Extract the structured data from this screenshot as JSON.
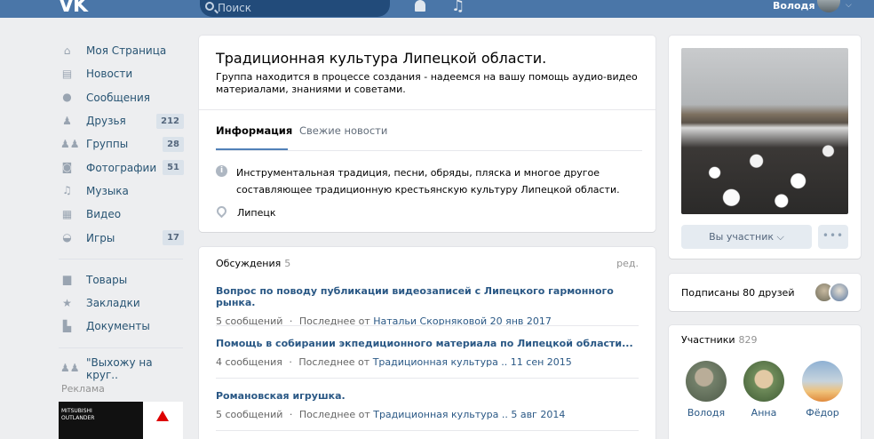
{
  "header": {
    "logo": "VK",
    "search_placeholder": "Поиск",
    "user_name": "Володя"
  },
  "nav": {
    "items": [
      {
        "label": "Моя Страница",
        "icon": "home-icon",
        "badge": ""
      },
      {
        "label": "Новости",
        "icon": "news-icon",
        "badge": ""
      },
      {
        "label": "Сообщения",
        "icon": "messages-icon",
        "badge": ""
      },
      {
        "label": "Друзья",
        "icon": "friends-icon",
        "badge": "212"
      },
      {
        "label": "Группы",
        "icon": "groups-icon",
        "badge": "28"
      },
      {
        "label": "Фотографии",
        "icon": "camera-icon",
        "badge": "51"
      },
      {
        "label": "Музыка",
        "icon": "music-icon",
        "badge": ""
      },
      {
        "label": "Видео",
        "icon": "video-icon",
        "badge": ""
      },
      {
        "label": "Игры",
        "icon": "gamepad-icon",
        "badge": "17"
      }
    ],
    "items2": [
      {
        "label": "Товары",
        "icon": "bag-icon"
      },
      {
        "label": "Закладки",
        "icon": "star-icon"
      },
      {
        "label": "Документы",
        "icon": "document-icon"
      }
    ],
    "items3": [
      {
        "label": "\"Выхожу на круг..",
        "icon": "group-icon"
      }
    ],
    "ads_label": "Реклама",
    "ad_text_1": "MITSUBISHI",
    "ad_text_2": "OUTLANDER"
  },
  "group": {
    "title": "Традиционная культура Липецкой области.",
    "status": "Группа находится в процессе создания - надеемся на вашу помощь аудио-видео материалами, знаниями и советами.",
    "tabs": [
      {
        "label": "Информация"
      },
      {
        "label": "Свежие новости"
      }
    ],
    "description": "Инструментальная традиция, песни, обряды, пляска и многое другое составляющее традиционную крестьянскую культуру Липецкой области.",
    "location": "Липецк"
  },
  "discussions": {
    "title": "Обсуждения",
    "count": "5",
    "edit": "ред.",
    "topics": [
      {
        "title": "Вопрос по поводу публикации видеозаписей с Липецкого гармонного рынка.",
        "count": "5 сообщений",
        "sep": "·",
        "last_prefix": "Последнее от",
        "last_link": "Натальи Скорняковой 20 янв 2017"
      },
      {
        "title": "Помощь в собирании экпедиционного материала по Липецкой области...",
        "count": "4 сообщения",
        "sep": "·",
        "last_prefix": "Последнее от",
        "last_link": "Традиционная культура .. 11 сен 2015"
      },
      {
        "title": "Романовская игрушка.",
        "count": "5 сообщений",
        "sep": "·",
        "last_prefix": "Последнее от",
        "last_link": "Традиционная культура .. 5 авг 2014"
      }
    ]
  },
  "sidebar": {
    "member_button": "Вы участник ⌵",
    "more_button": "•••",
    "friends_text": "Подписаны 80 друзей",
    "members_title": "Участники",
    "members_count": "829",
    "members": [
      {
        "name": "Володя"
      },
      {
        "name": "Анна"
      },
      {
        "name": "Фёдор"
      }
    ]
  },
  "colors": {
    "header": "#4a76a8",
    "link": "#2a5885",
    "background": "#edeef0"
  }
}
